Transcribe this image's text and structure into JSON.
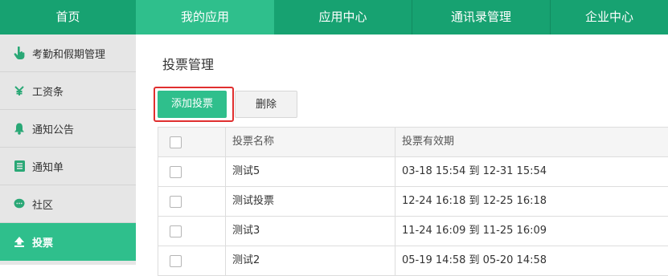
{
  "topnav": {
    "items": [
      {
        "label": "首页",
        "active": false
      },
      {
        "label": "我的应用",
        "active": true
      },
      {
        "label": "应用中心",
        "active": false
      },
      {
        "label": "通讯录管理",
        "active": false
      },
      {
        "label": "企业中心",
        "active": false
      }
    ]
  },
  "sidebar": {
    "items": [
      {
        "label": "考勤和假期管理",
        "icon": "hand-pointer-icon"
      },
      {
        "label": "工资条",
        "icon": "money-icon"
      },
      {
        "label": "通知公告",
        "icon": "bell-icon"
      },
      {
        "label": "通知单",
        "icon": "list-icon"
      },
      {
        "label": "社区",
        "icon": "chat-bubble-icon"
      },
      {
        "label": "投票",
        "icon": "upload-icon",
        "active": true
      }
    ]
  },
  "main": {
    "title": "投票管理",
    "add_button": "添加投票",
    "delete_button": "删除",
    "table": {
      "headers": [
        "投票名称",
        "投票有效期"
      ],
      "rows": [
        {
          "name": "测试5",
          "validity": "03-18 15:54 到 12-31 15:54"
        },
        {
          "name": "测试投票",
          "validity": "12-24 16:18 到 12-25 16:18"
        },
        {
          "name": "测试3",
          "validity": "11-24 16:09 到 11-25 16:09"
        },
        {
          "name": "测试2",
          "validity": "05-19 14:58 到 05-20 14:58"
        }
      ]
    }
  },
  "colors": {
    "nav_bg": "#17a271",
    "accent": "#2fbf8c",
    "highlight_outline": "#e02f2f",
    "sidebar_bg": "#e6e6e6"
  }
}
